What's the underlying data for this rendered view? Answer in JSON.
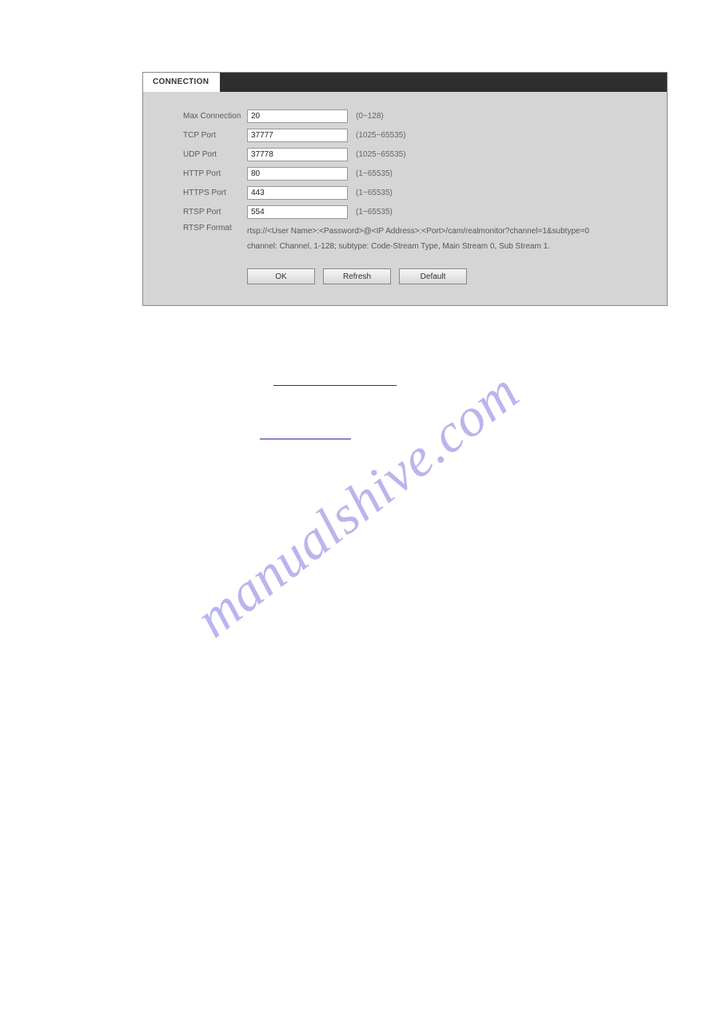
{
  "panel": {
    "tab": "CONNECTION",
    "rows": {
      "max_connection": {
        "label": "Max Connection",
        "value": "20",
        "hint": "(0~128)"
      },
      "tcp_port": {
        "label": "TCP Port",
        "value": "37777",
        "hint": "(1025~65535)"
      },
      "udp_port": {
        "label": "UDP Port",
        "value": "37778",
        "hint": "(1025~65535)"
      },
      "http_port": {
        "label": "HTTP Port",
        "value": "80",
        "hint": "(1~65535)"
      },
      "https_port": {
        "label": "HTTPS Port",
        "value": "443",
        "hint": "(1~65535)"
      },
      "rtsp_port": {
        "label": "RTSP Port",
        "value": "554",
        "hint": "(1~65535)"
      },
      "rtsp_format": {
        "label": "RTSP Format",
        "line1": "rtsp://<User Name>:<Password>@<IP Address>:<Port>/cam/realmonitor?channel=1&subtype=0",
        "line2": "channel: Channel, 1-128; subtype: Code-Stream Type, Main Stream 0, Sub Stream 1."
      }
    },
    "buttons": {
      "ok": "OK",
      "refresh": "Refresh",
      "default": "Default"
    }
  },
  "watermark": "manualshive.com"
}
